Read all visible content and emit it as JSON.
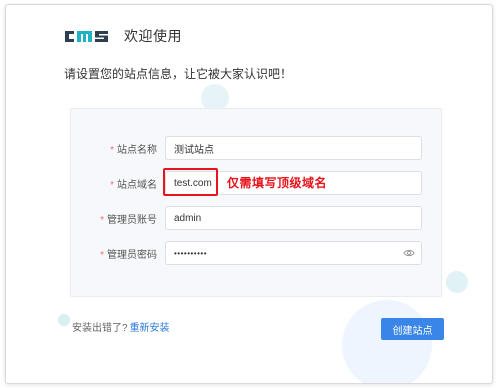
{
  "header": {
    "logo_text": "cms",
    "title": "欢迎使用"
  },
  "intro": "请设置您的站点信息，让它被大家认识吧！",
  "form": {
    "fields": [
      {
        "label": "站点名称",
        "value": "测试站点"
      },
      {
        "label": "站点域名",
        "value": "test.com",
        "hint": "仅需填写顶级域名"
      },
      {
        "label": "管理员账号",
        "value": "admin"
      },
      {
        "label": "管理员密码",
        "value": "••••••••••"
      }
    ]
  },
  "footer": {
    "question": "安装出错了?",
    "reinstall_link": "重新安装"
  },
  "create_button": "创建站点",
  "colors": {
    "accent": "#3a86e8",
    "highlight": "#e8141c",
    "required": "#f56c6c"
  }
}
